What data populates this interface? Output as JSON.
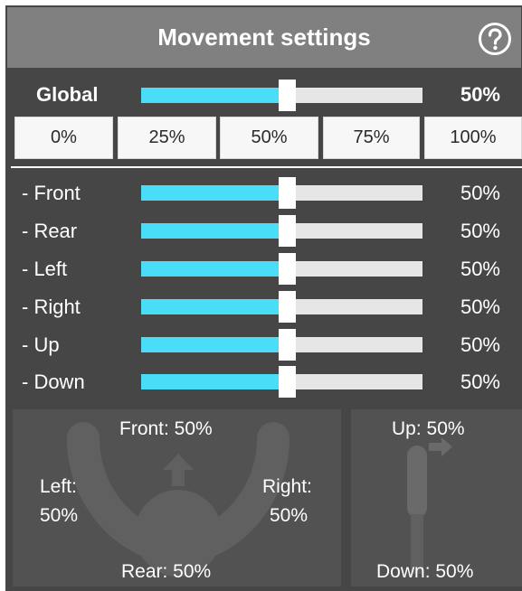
{
  "header": {
    "title": "Movement settings",
    "help_icon": "question-circle-icon"
  },
  "global": {
    "label": "Global",
    "value_text": "50%",
    "value": 0.5
  },
  "presets": [
    "0%",
    "25%",
    "50%",
    "75%",
    "100%"
  ],
  "axes": [
    {
      "label": "- Front",
      "value_text": "50%",
      "value": 0.5
    },
    {
      "label": "- Rear",
      "value_text": "50%",
      "value": 0.5
    },
    {
      "label": "- Left",
      "value_text": "50%",
      "value": 0.5
    },
    {
      "label": "- Right",
      "value_text": "50%",
      "value": 0.5
    },
    {
      "label": "- Up",
      "value_text": "50%",
      "value": 0.5
    },
    {
      "label": "- Down",
      "value_text": "50%",
      "value": 0.5
    }
  ],
  "visual": {
    "front": "Front: 50%",
    "rear": "Rear: 50%",
    "left_line1": "Left:",
    "left_line2": "50%",
    "right_line1": "Right:",
    "right_line2": "50%",
    "up": "Up: 50%",
    "down": "Down: 50%"
  },
  "colors": {
    "slider_fill": "#49ddf7",
    "slider_track": "#e6e6e6",
    "panel_bg": "#464646",
    "header_bg": "#808080"
  }
}
